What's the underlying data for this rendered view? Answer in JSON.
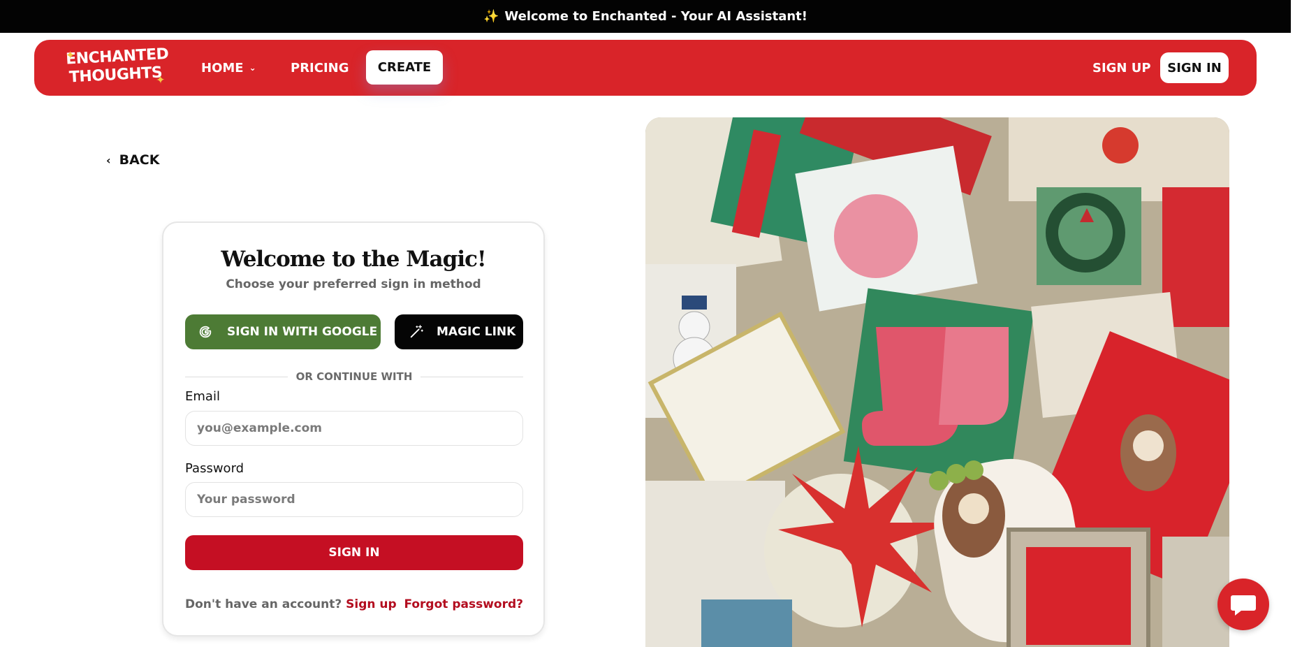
{
  "announcement": {
    "icon": "sparkles-icon",
    "text": "Welcome to Enchanted - Your AI Assistant!"
  },
  "navbar": {
    "logo": {
      "line1": "ENCHANTED",
      "line2": "THOUGHTS"
    },
    "home": "HOME",
    "pricing": "PRICING",
    "create": "CREATE",
    "sign_up": "SIGN UP",
    "sign_in": "SIGN IN",
    "accent": "#d92429"
  },
  "back": {
    "label": "BACK"
  },
  "card": {
    "title": "Welcome to the Magic!",
    "subtitle": "Choose your preferred sign in method",
    "google_button": "SIGN IN WITH GOOGLE",
    "magic_button": "MAGIC LINK",
    "divider": "OR CONTINUE WITH",
    "email_label": "Email",
    "email_placeholder": "you@example.com",
    "password_label": "Password",
    "password_placeholder": "Your password",
    "submit": "SIGN IN",
    "no_account": "Don't have an account?",
    "sign_up_link": "Sign up",
    "forgot": "Forgot password?"
  },
  "colors": {
    "google_green": "#4d7b35",
    "submit_red": "#c50f23",
    "link_red": "#b30d1f"
  },
  "chat_fab": {
    "icon": "chat-bubble-icon"
  }
}
